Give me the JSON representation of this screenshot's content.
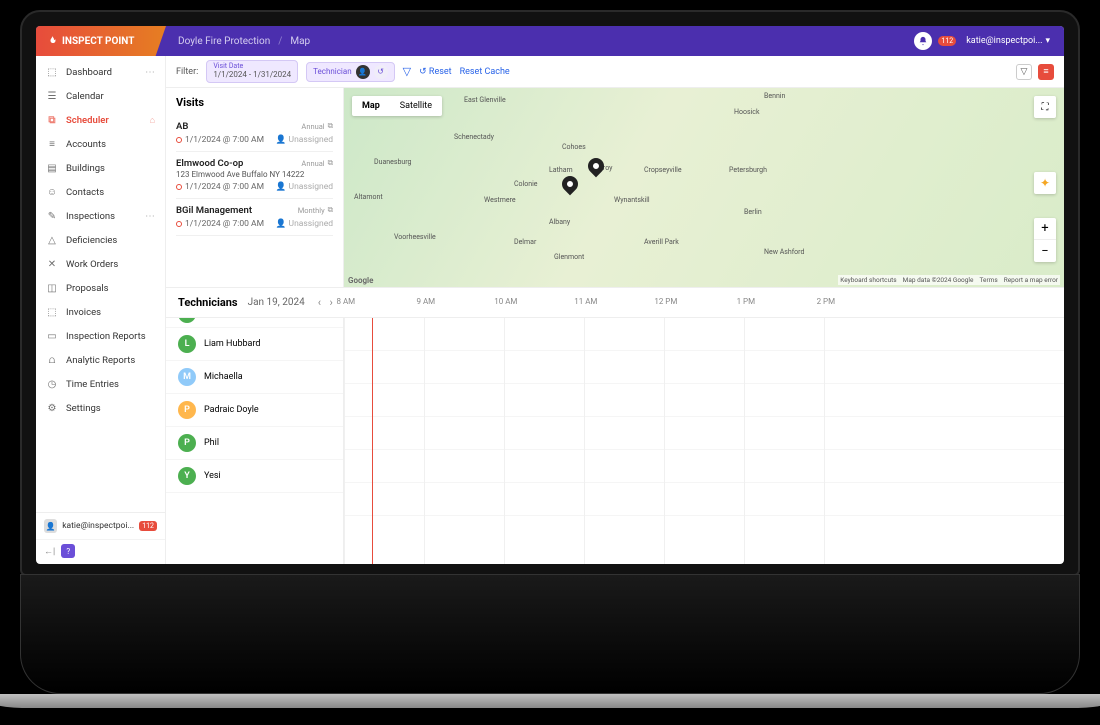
{
  "brand": "INSPECT POINT",
  "breadcrumb": {
    "org": "Doyle Fire Protection",
    "page": "Map"
  },
  "notifications": "112",
  "user": "katie@inspectpoi...",
  "sidebar": {
    "items": [
      {
        "label": "Dashboard",
        "icon": "⬚",
        "dots": true
      },
      {
        "label": "Calendar",
        "icon": "☰"
      },
      {
        "label": "Scheduler",
        "icon": "⧉",
        "active": true,
        "side": "⌂"
      },
      {
        "label": "Accounts",
        "icon": "≡"
      },
      {
        "label": "Buildings",
        "icon": "▤"
      },
      {
        "label": "Contacts",
        "icon": "☺"
      },
      {
        "label": "Inspections",
        "icon": "✎",
        "dots": true
      },
      {
        "label": "Deficiencies",
        "icon": "△"
      },
      {
        "label": "Work Orders",
        "icon": "✕"
      },
      {
        "label": "Proposals",
        "icon": "◫"
      },
      {
        "label": "Invoices",
        "icon": "⬚"
      },
      {
        "label": "Inspection Reports",
        "icon": "▭"
      },
      {
        "label": "Analytic Reports",
        "icon": "⩍"
      },
      {
        "label": "Time Entries",
        "icon": "◷"
      },
      {
        "label": "Settings",
        "icon": "⚙"
      }
    ],
    "footer_user": "katie@inspectpoi...",
    "footer_badge": "112"
  },
  "filters": {
    "label": "Filter:",
    "visit_date_label": "Visit Date",
    "visit_date_value": "1/1/2024 - 1/31/2024",
    "technician_label": "Technician",
    "reset": "Reset",
    "reset_cache": "Reset Cache"
  },
  "visits": {
    "title": "Visits",
    "items": [
      {
        "name": "AB",
        "freq": "Annual",
        "time": "1/1/2024 @ 7:00 AM",
        "assignee": "Unassigned"
      },
      {
        "name": "Elmwood Co-op",
        "addr": "123 Elmwood Ave Buffalo NY 14222",
        "freq": "Annual",
        "time": "1/1/2024 @ 7:00 AM",
        "assignee": "Unassigned"
      },
      {
        "name": "BGil Management",
        "freq": "Monthly",
        "time": "1/1/2024 @ 7:00 AM",
        "assignee": "Unassigned"
      }
    ]
  },
  "map": {
    "map_label": "Map",
    "sat_label": "Satellite",
    "labels": [
      "East Glenville",
      "Bennin",
      "Hoosick",
      "Schenectady",
      "Cohoes",
      "Duanesburg",
      "Latham",
      "Troy",
      "Cropseyville",
      "Petersburgh",
      "Colonie",
      "Altamont",
      "Westmere",
      "Wynantskill",
      "Albany",
      "Berlin",
      "Voorheesville",
      "Delmar",
      "Averill Park",
      "Glenmont",
      "New Ashford"
    ],
    "attribution": [
      "Keyboard shortcuts",
      "Map data ©2024 Google",
      "Terms",
      "Report a map error"
    ],
    "google": "Google"
  },
  "technicians": {
    "title": "Technicians",
    "date": "Jan 19, 2024",
    "hours": [
      "8 AM",
      "9 AM",
      "10 AM",
      "11 AM",
      "12 PM",
      "1 PM",
      "2 PM"
    ],
    "rows": [
      {
        "initial": "L",
        "name": "Liam Hubbard",
        "color": "#4CAF50"
      },
      {
        "initial": "M",
        "name": "Michaella",
        "color": "#90CAF9"
      },
      {
        "initial": "P",
        "name": "Padraic Doyle",
        "color": "#FFB74D"
      },
      {
        "initial": "P",
        "name": "Phil",
        "color": "#4CAF50"
      },
      {
        "initial": "Y",
        "name": "Yesi",
        "color": "#4CAF50"
      }
    ]
  }
}
